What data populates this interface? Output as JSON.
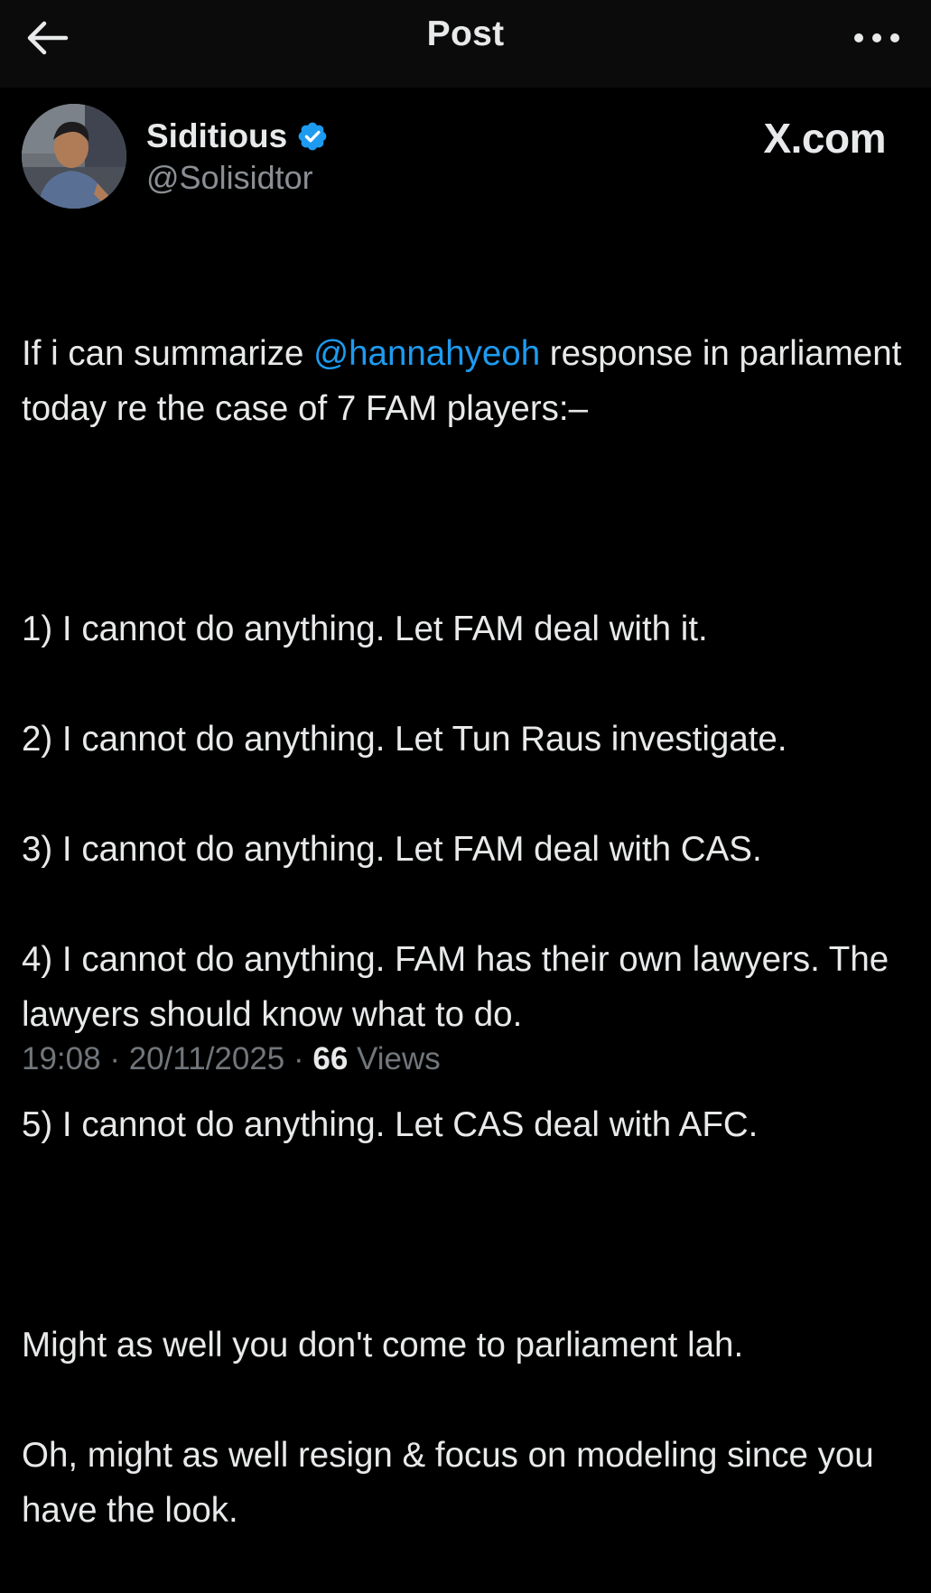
{
  "header": {
    "title": "Post",
    "back_icon": "arrow-left-icon",
    "more_icon": "more-horizontal-icon"
  },
  "author": {
    "name": "Siditious",
    "handle": "@Solisidtor",
    "verified_icon": "verified-badge-icon",
    "verified_color": "#1d9bf0"
  },
  "brand": "X.com",
  "post": {
    "intro_before": "If i can summarize ",
    "mention": "@hannahyeoh",
    "intro_after": " response in parliament today re the case of 7 FAM players:–",
    "items": [
      "1) I cannot do anything. Let FAM deal with it.",
      "2) I cannot do anything. Let Tun Raus investigate.",
      "3) I cannot do anything. Let FAM deal with CAS.",
      "4) I cannot do anything. FAM has their own lawyers. The lawyers should know what to do.",
      "5) I cannot do anything. Let CAS deal with AFC."
    ],
    "closing_1": "Might as well you don't come to parliament lah.",
    "closing_2": "Oh, might as well resign & focus on modeling since you have the look."
  },
  "meta": {
    "time": "19:08",
    "separator": " · ",
    "date": "20/11/2025",
    "views_count": "66",
    "views_label": " Views"
  },
  "colors": {
    "background": "#000000",
    "header_bg": "#0b0b0b",
    "text": "#e7e9ea",
    "secondary": "#71767b",
    "link": "#1d9bf0"
  }
}
